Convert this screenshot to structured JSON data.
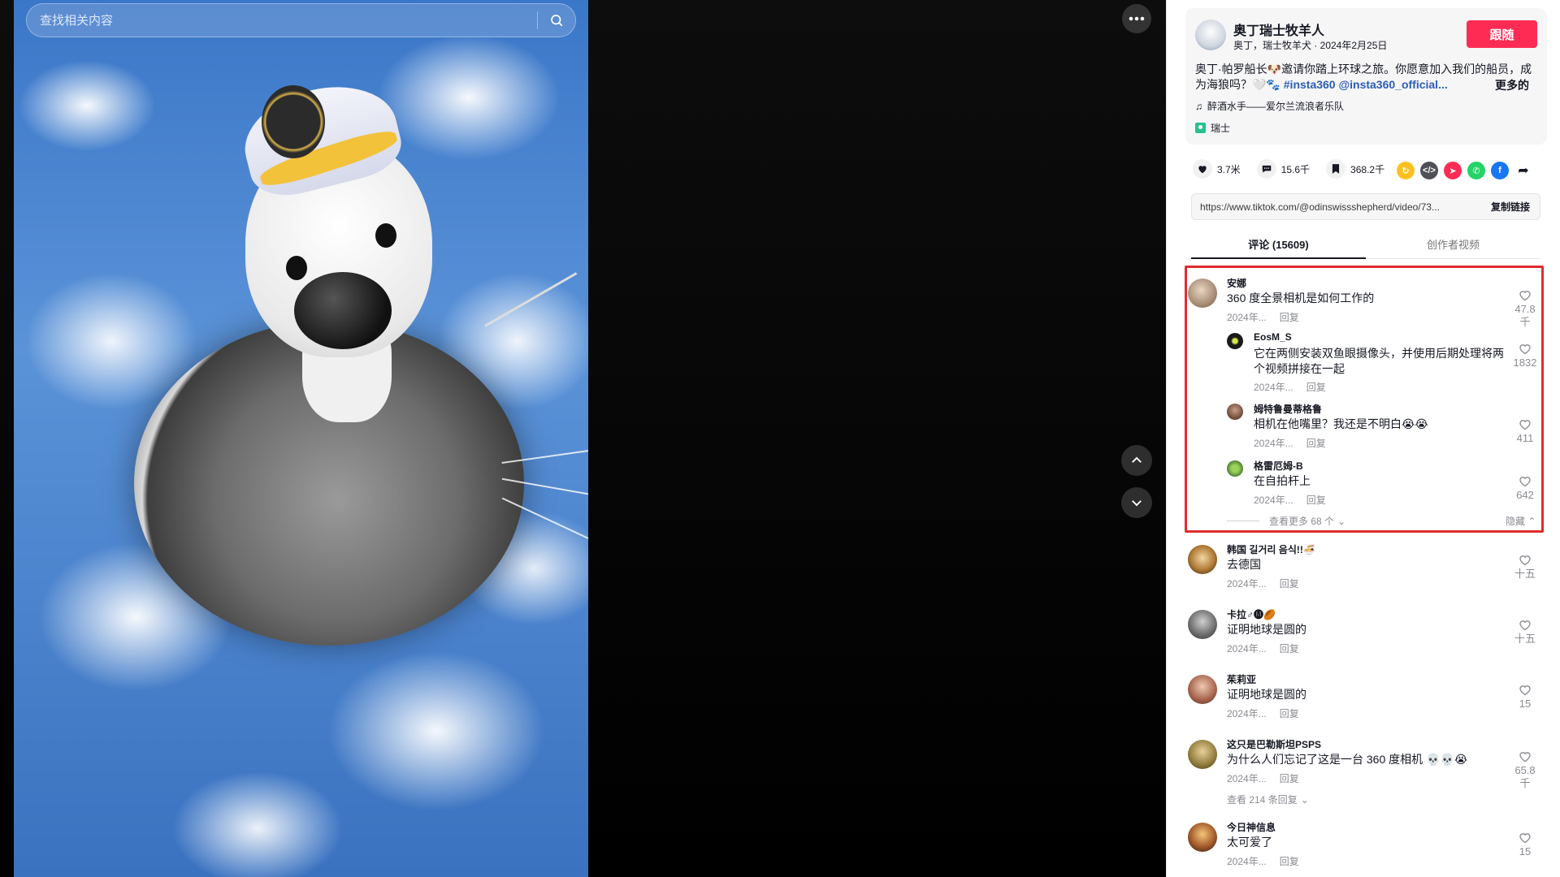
{
  "search": {
    "placeholder": "查找相关内容"
  },
  "author": {
    "name": "奥丁瑞士牧羊人",
    "sub": "奥丁，瑞士牧羊犬 · 2024年2月25日",
    "follow_label": "跟随"
  },
  "description": {
    "text": "奥丁·帕罗船长🐶邀请你踏上环球之旅。你愿意加入我们的船员，成为海狼吗？🤍🐾 ",
    "tags": "#insta360 @insta360_official...",
    "more_label": "更多的"
  },
  "music": "醉酒水手——爱尔兰流浪者乐队",
  "location": "瑞士",
  "actions": {
    "likes": "3.7米",
    "comments": "15.6千",
    "saves": "368.2千"
  },
  "share_icons": [
    "repost-icon",
    "embed-icon",
    "send-icon",
    "whatsapp-icon",
    "facebook-icon",
    "share-arrow-icon"
  ],
  "link": {
    "url": "https://www.tiktok.com/@odinswissshepherd/video/73...",
    "copy_label": "复制链接"
  },
  "tabs": {
    "comments": "评论 (15609)",
    "creator_videos": "创作者视频"
  },
  "comments": [
    {
      "name": "安娜",
      "text": "360 度全景相机是如何工作的",
      "date": "2024年...",
      "reply": "回复",
      "likes": "47.8千"
    },
    {
      "name": "EosM_S",
      "text": "它在两侧安装双鱼眼摄像头，并使用后期处理将两个视频拼接在一起",
      "date": "2024年...",
      "reply": "回复",
      "likes": "1832"
    },
    {
      "name": "姆特鲁曼蒂格鲁",
      "text": "相机在他嘴里？我还是不明白😭😭",
      "date": "2024年...",
      "reply": "回复",
      "likes": "411"
    },
    {
      "name": "格雷厄姆-B",
      "text": "在自拍杆上",
      "date": "2024年...",
      "reply": "回复",
      "likes": "642"
    },
    {
      "name": "韩国 길거리 음식!!🍜",
      "text": "去德国",
      "date": "2024年...",
      "reply": "回复",
      "likes": "十五"
    },
    {
      "name": "卡拉♂🅜🏉",
      "text": "证明地球是圆的",
      "date": "2024年...",
      "reply": "回复",
      "likes": "十五"
    },
    {
      "name": "茱莉亚",
      "text": "证明地球是圆的",
      "date": "2024年...",
      "reply": "回复",
      "likes": "15"
    },
    {
      "name": "这只是巴勒斯坦PSPS",
      "text": "为什么人们忘记了这是一台 360 度相机 💀💀😭",
      "date": "2024年...",
      "reply": "回复",
      "likes": "65.8千"
    },
    {
      "name": "今日神信息",
      "text": "太可爱了",
      "date": "2024年...",
      "reply": "回复",
      "likes": "15"
    }
  ],
  "view_more_replies": "查看更多 68 个",
  "hide_label": "隐藏",
  "view_more_214": "查看 214 条回复"
}
